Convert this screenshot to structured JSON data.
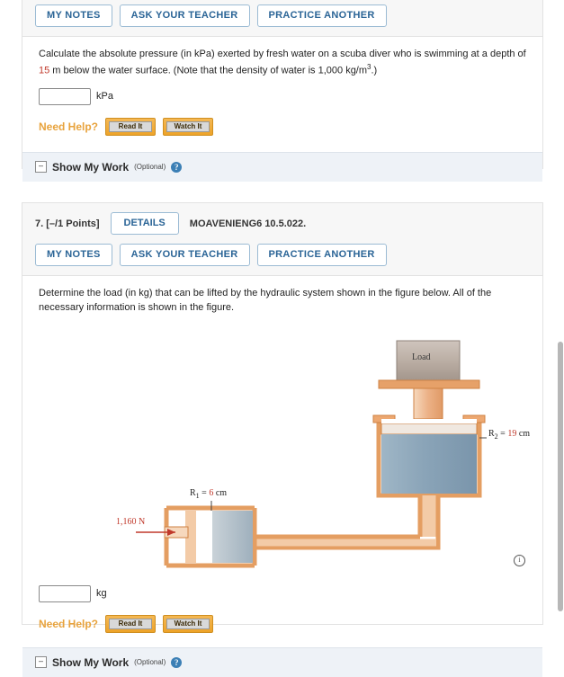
{
  "problem6": {
    "tabs": [
      "MY NOTES",
      "ASK YOUR TEACHER",
      "PRACTICE ANOTHER"
    ],
    "question_part1": "Calculate the absolute pressure (in kPa) exerted by fresh water on a scuba diver who is swimming at a depth of ",
    "depth_value": "15",
    "question_part2": " m below the water surface. (Note that the density of water is 1,000 kg/m",
    "density_exp": "3",
    "question_part3": ".)",
    "answer_value": "",
    "answer_unit": "kPa",
    "need_help_label": "Need Help?",
    "read_it": "Read It",
    "watch_it": "Watch It",
    "show_my_work": "Show My Work",
    "optional": "(Optional)",
    "toggle_glyph": "–",
    "info_glyph": "?"
  },
  "problem7": {
    "points": "7.  [–/1 Points]",
    "details": "DETAILS",
    "code": "MOAVENIENG6 10.5.022.",
    "tabs": [
      "MY NOTES",
      "ASK YOUR TEACHER",
      "PRACTICE ANOTHER"
    ],
    "question": "Determine the load (in kg) that can be lifted by the hydraulic system shown in the figure below. All of the necessary information is shown in the figure.",
    "answer_value": "",
    "answer_unit": "kg",
    "need_help_label": "Need Help?",
    "read_it": "Read It",
    "watch_it": "Watch It",
    "show_my_work": "Show My Work",
    "optional": "(Optional)",
    "toggle_glyph": "–",
    "info_glyph": "?",
    "figure": {
      "load_label": "Load",
      "r2_symbol": "R",
      "r2_sub": "2",
      "r2_eq": " = ",
      "r2_value": "19",
      "r2_unit": " cm",
      "r1_symbol": "R",
      "r1_sub": "1",
      "r1_eq": " = ",
      "r1_value": "6",
      "r1_unit": " cm",
      "force_label": "1,160 N",
      "info_glyph": "i"
    }
  },
  "colors": {
    "accent_blue": "#2a6496",
    "red_value": "#c0392b",
    "orange_button": "#eda329",
    "pipe_orange": "#e8a063",
    "fluid_blue": "#8ba9bf"
  }
}
